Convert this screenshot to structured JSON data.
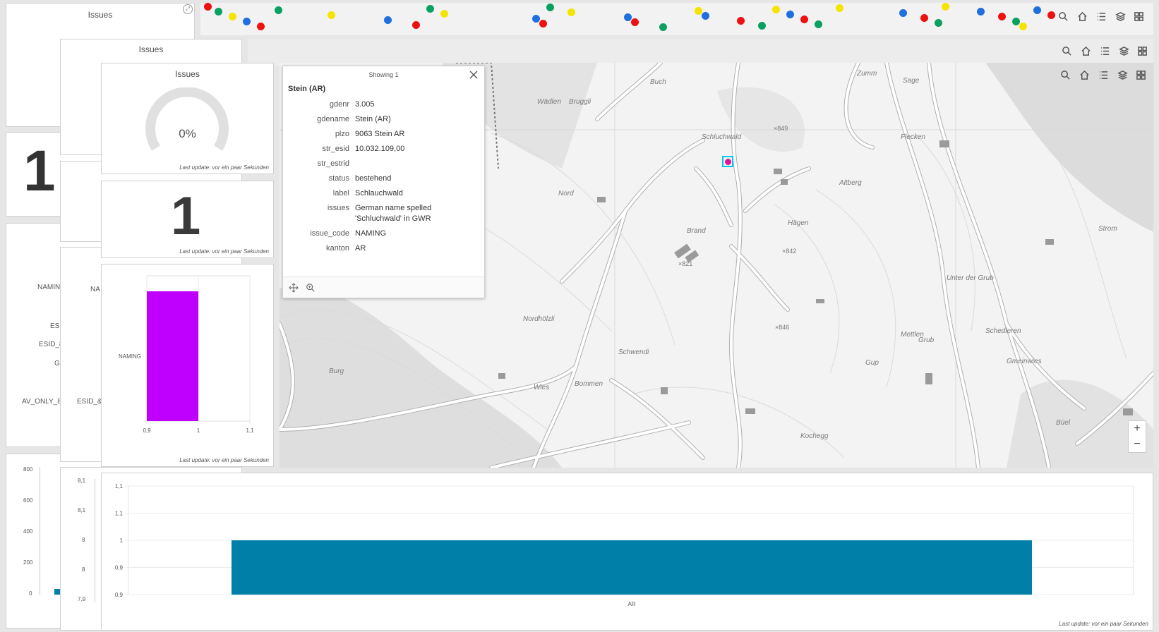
{
  "widgets": {
    "issues_title": "Issues",
    "gauge_value": "0%",
    "count_value": "1",
    "last_update": "Last update: vor ein paar Sekunden"
  },
  "bg_layers": {
    "count_far": "1",
    "categories_far": [
      "NAMIN",
      "ES",
      "ESID_8",
      "G",
      "AV_ONLY_8"
    ],
    "categories_mid": [
      "NA",
      "ESID_&"
    ],
    "far_axis": [
      "800",
      "600",
      "400",
      "200",
      "0"
    ],
    "mid_axis": [
      "8,1",
      "8,1",
      "8",
      "8",
      "7,9"
    ]
  },
  "popup": {
    "header": "Showing 1",
    "title": "Stein (AR)",
    "attributes": [
      {
        "key": "gdenr",
        "value": "3.005"
      },
      {
        "key": "gdename",
        "value": "Stein (AR)"
      },
      {
        "key": "plzo",
        "value": "9063 Stein AR"
      },
      {
        "key": "str_esid",
        "value": "10.032.109,00"
      },
      {
        "key": "str_estrid",
        "value": ""
      },
      {
        "key": "status",
        "value": "bestehend"
      },
      {
        "key": "label",
        "value": "Schlauchwald"
      },
      {
        "key": "issues",
        "value": "German name spelled 'Schluchwald' in GWR"
      },
      {
        "key": "issue_code",
        "value": "NAMING"
      },
      {
        "key": "kanton",
        "value": "AR"
      }
    ]
  },
  "map": {
    "labels": [
      "Buch",
      "Wädlen",
      "Bruggli",
      "Zumm",
      "Sage",
      "Flecken",
      "Altberg",
      "Hägen",
      "Brand",
      "Nord",
      "Nordhölzli",
      "Schwendi",
      "Wies",
      "Bommen",
      "Burg",
      "Mettlen",
      "Gup",
      "Grub",
      "Schedleren",
      "Gmeinwies",
      "Strom",
      "Kochegg",
      "Büel",
      "Schluchwald",
      "Unter der Grub"
    ],
    "spot_heights": [
      "×849",
      "×842",
      "×821",
      "×846"
    ],
    "zoom_in": "+",
    "zoom_out": "−"
  },
  "colors": {
    "magenta_bar": "#c000ff",
    "teal_bar": "#0080a8",
    "selection": "#e0119a",
    "dot_red": "#ee1111",
    "dot_blue": "#1f6fe0",
    "dot_yellow": "#f5e400",
    "dot_green": "#0aa060"
  },
  "chart_data": [
    {
      "type": "bar",
      "orientation": "horizontal",
      "categories": [
        "NAMING"
      ],
      "values": [
        1
      ],
      "xlim": [
        0.9,
        1.1
      ],
      "xticks": [
        "0,9",
        "1",
        "1,1"
      ],
      "color": "#c000ff"
    },
    {
      "type": "bar",
      "categories": [
        "AR"
      ],
      "values": [
        1
      ],
      "ylim": [
        0.9,
        1.1
      ],
      "yticks": [
        "1,1",
        "1,1",
        "1",
        "0,9",
        "0,9"
      ],
      "color": "#0080a8"
    }
  ]
}
